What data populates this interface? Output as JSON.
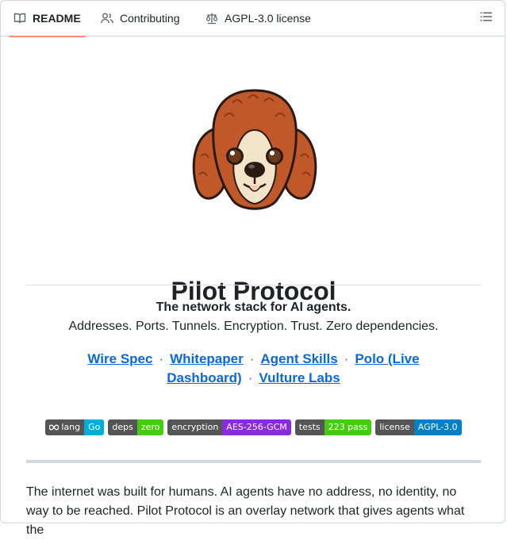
{
  "tabs": [
    {
      "label": "README",
      "icon": "book-icon",
      "active": true
    },
    {
      "label": "Contributing",
      "icon": "people-icon",
      "active": false
    },
    {
      "label": "AGPL-3.0 license",
      "icon": "law-icon",
      "active": false
    }
  ],
  "readme": {
    "title": "Pilot Protocol",
    "tagline": "The network stack for AI agents.",
    "subtagline": "Addresses. Ports. Tunnels. Encryption. Trust. Zero dependencies.",
    "links": [
      "Wire Spec",
      "Whitepaper",
      "Agent Skills",
      "Polo (Live Dashboard)",
      "Vulture Labs"
    ],
    "link_separator": "·",
    "badges": [
      {
        "label": "lang",
        "value": "Go",
        "color": "#00add8",
        "icon": "infinity-icon"
      },
      {
        "label": "deps",
        "value": "zero",
        "color": "#4c1"
      },
      {
        "label": "encryption",
        "value": "AES-256-GCM",
        "color": "#8a2be2"
      },
      {
        "label": "tests",
        "value": "223 pass",
        "color": "#4c1"
      },
      {
        "label": "license",
        "value": "AGPL-3.0",
        "color": "#007ec6"
      }
    ],
    "intro": "The internet was built for humans. AI agents have no address, no identity, no way to be reached. Pilot Protocol is an overlay network that gives agents what the"
  },
  "colors": {
    "accent": "#fd8c73",
    "link": "#0969da"
  }
}
